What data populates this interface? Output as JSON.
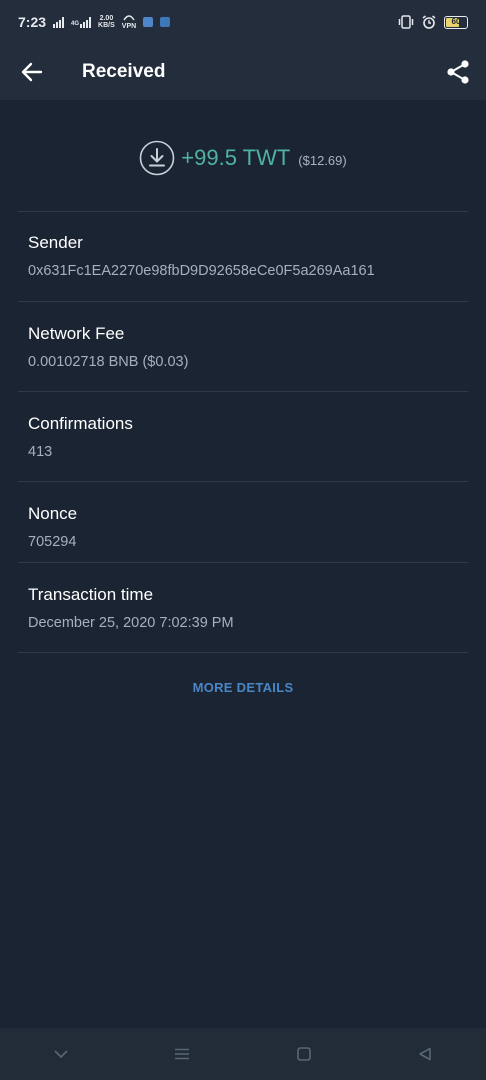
{
  "status_bar": {
    "time": "7:23",
    "net_speed_value": "2.00",
    "net_speed_unit": "KB/S",
    "vpn_label": "VPN",
    "signal_label": "4G",
    "battery_level": "60"
  },
  "header": {
    "title": "Received"
  },
  "transaction": {
    "amount": "+99.5 TWT",
    "amount_fiat": "($12.69)",
    "amount_color": "#4fb3a0"
  },
  "fields": [
    {
      "label": "Sender",
      "value": "0x631Fc1EA2270e98fbD9D92658eCe0F5a269Aa161"
    },
    {
      "label": "Network Fee",
      "value": "0.00102718 BNB ($0.03)"
    },
    {
      "label": "Confirmations",
      "value": "413"
    },
    {
      "label": "Nonce",
      "value": "705294"
    },
    {
      "label": "Transaction time",
      "value": "December 25, 2020 7:02:39 PM"
    }
  ],
  "more_details_label": "MORE DETAILS",
  "colors": {
    "background": "#1b2433",
    "bar": "#232d3b",
    "link": "#4a86c5"
  }
}
